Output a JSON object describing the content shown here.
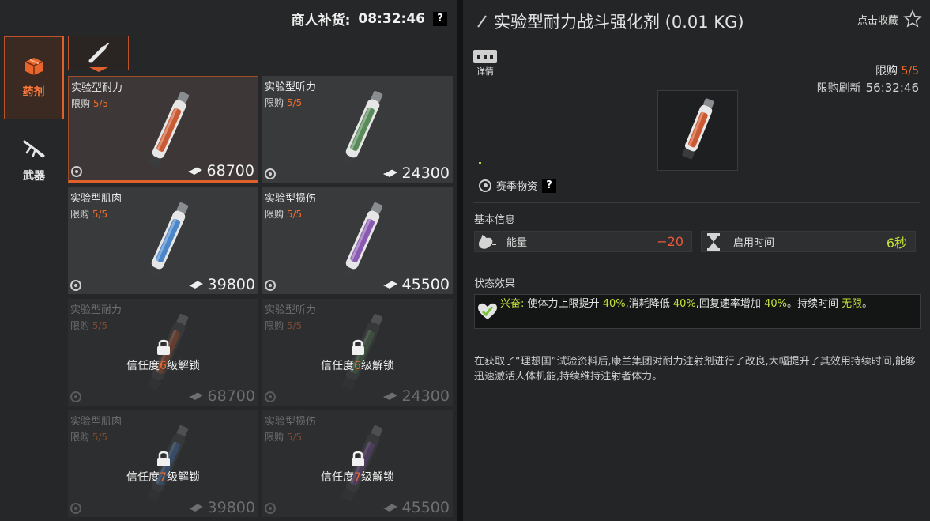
{
  "merchant": {
    "restock_label": "商人补货:",
    "restock_time": "08:32:46",
    "help": "?"
  },
  "categories": [
    {
      "label": "药剂",
      "icon": "box-icon",
      "active": true
    },
    {
      "label": "武器",
      "icon": "rifle-icon",
      "active": false
    }
  ],
  "subtab": {
    "icon": "syringe-icon"
  },
  "items": [
    {
      "name": "实验型耐力",
      "limit_label": "限购",
      "limit": "5/5",
      "price": "68700",
      "color": "#c85a34",
      "locked": false,
      "selected": true
    },
    {
      "name": "实验型听力",
      "limit_label": "限购",
      "limit": "5/5",
      "price": "24300",
      "color": "#5a8a5a",
      "locked": false,
      "selected": false
    },
    {
      "name": "实验型肌肉",
      "limit_label": "限购",
      "limit": "5/5",
      "price": "39800",
      "color": "#4a86c8",
      "locked": false,
      "selected": false
    },
    {
      "name": "实验型损伤",
      "limit_label": "限购",
      "limit": "5/5",
      "price": "45500",
      "color": "#8a5ab0",
      "locked": false,
      "selected": false
    },
    {
      "name": "实验型耐力",
      "limit_label": "限购",
      "limit": "5/5",
      "price": "68700",
      "color": "#c85a34",
      "locked": true,
      "unlock_pre": "信任度",
      "unlock_level": "6",
      "unlock_post": "级解锁"
    },
    {
      "name": "实验型听力",
      "limit_label": "限购",
      "limit": "5/5",
      "price": "24300",
      "color": "#5a8a5a",
      "locked": true,
      "unlock_pre": "信任度",
      "unlock_level": "6",
      "unlock_post": "级解锁"
    },
    {
      "name": "实验型肌肉",
      "limit_label": "限购",
      "limit": "5/5",
      "price": "39800",
      "color": "#4a86c8",
      "locked": true,
      "unlock_pre": "信任度",
      "unlock_level": "7",
      "unlock_post": "级解锁"
    },
    {
      "name": "实验型损伤",
      "limit_label": "限购",
      "limit": "5/5",
      "price": "45500",
      "color": "#8a5ab0",
      "locked": true,
      "unlock_pre": "信任度",
      "unlock_level": "7",
      "unlock_post": "级解锁"
    }
  ],
  "detail": {
    "title": "实验型耐力战斗强化剂 (0.01 KG)",
    "favorite_label": "点击收藏",
    "details_label": "详情",
    "limit_label": "限购",
    "limit_value": "5/5",
    "refresh_label": "限购刷新",
    "refresh_time": "56:32:46",
    "season_label": "赛季物资",
    "season_help": "?",
    "basic_info_title": "基本信息",
    "stats": [
      {
        "label": "能量",
        "value": "−20",
        "value_color": "#e8583a",
        "icon": "stomach-icon"
      },
      {
        "label": "启用时间",
        "value": "6秒",
        "value_color": "#c4e03a",
        "icon": "hourglass-icon"
      }
    ],
    "effects_title": "状态效果",
    "effect": {
      "name": "兴奋:",
      "t1": "使体力上限提升",
      "v1": "40%",
      "t2": ",消耗降低",
      "v2": "40%",
      "t3": ",回复速率增加",
      "v3": "40%",
      "t4": "。持续时间",
      "v4": "无限",
      "t5": "。"
    },
    "description": "在获取了“理想国”试验资料后,康兰集团对耐力注射剂进行了改良,大幅提升了其效用持续时间,能够迅速激活人体机能,持续维持注射者体力。"
  }
}
